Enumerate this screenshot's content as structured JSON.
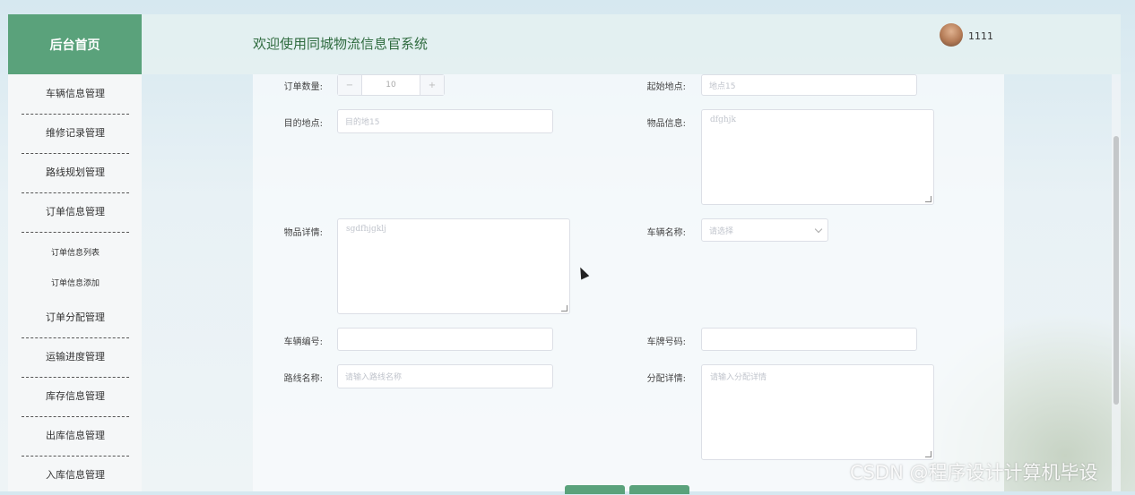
{
  "sidebar": {
    "home_label": "后台首页",
    "items": [
      {
        "label": "车辆信息管理"
      },
      {
        "label": "维修记录管理"
      },
      {
        "label": "路线规划管理"
      },
      {
        "label": "订单信息管理"
      },
      {
        "label": "订单分配管理"
      },
      {
        "label": "运输进度管理"
      },
      {
        "label": "库存信息管理"
      },
      {
        "label": "出库信息管理"
      },
      {
        "label": "入库信息管理"
      }
    ],
    "subitems": [
      {
        "label": "订单信息列表"
      },
      {
        "label": "订单信息添加"
      }
    ]
  },
  "header": {
    "welcome": "欢迎使用同城物流信息官系统",
    "username": "1111"
  },
  "form": {
    "order_qty": {
      "label": "订单数量:",
      "value": "10",
      "minus": "−",
      "plus": "+"
    },
    "start": {
      "label": "起始地点:",
      "value": "地点15"
    },
    "destination": {
      "label": "目的地点:",
      "value": "目的地15"
    },
    "goods_info": {
      "label": "物品信息:",
      "value": "dfghjk"
    },
    "goods_detail": {
      "label": "物品详情:",
      "value": "sgdfhjgklj"
    },
    "vehicle_name": {
      "label": "车辆名称:",
      "placeholder": "请选择"
    },
    "vehicle_no": {
      "label": "车辆编号:",
      "value": ""
    },
    "plate_no": {
      "label": "车牌号码:",
      "value": ""
    },
    "route_name": {
      "label": "路线名称:",
      "placeholder": "请输入路线名称"
    },
    "assign_detail": {
      "label": "分配详情:",
      "placeholder": "请输入分配详情"
    }
  },
  "watermark": "CSDN @程序设计计算机毕设"
}
